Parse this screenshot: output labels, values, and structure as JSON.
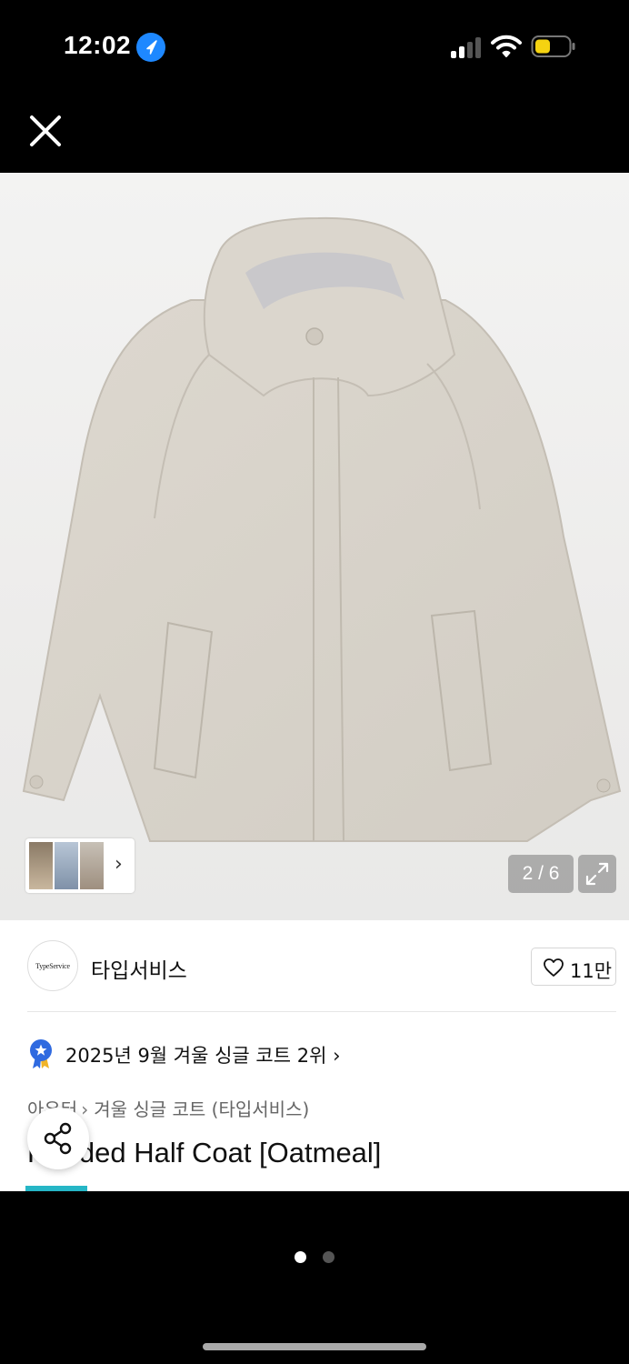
{
  "status_bar": {
    "time": "12:02",
    "icons": [
      "location-arrow-icon",
      "signal-icon",
      "wifi-icon",
      "battery-icon"
    ],
    "battery_color": "#f5d311"
  },
  "nav": {
    "close_icon": "close-icon"
  },
  "gallery": {
    "page_indicator": "2 / 6",
    "thumbnail_chevron": "›",
    "expand_icon": "expand-icon"
  },
  "brand": {
    "logo_text": "TypeService",
    "name": "타입서비스",
    "like_count": "11만"
  },
  "ranking": {
    "text": "2025년 9월 겨울 싱글 코트 2위",
    "chevron": "›",
    "badge_color": "#2f6ae0"
  },
  "breadcrumb": {
    "items": [
      "아우터",
      "겨울 싱글 코트 (타입서비스)"
    ],
    "separator": "›"
  },
  "product": {
    "title": "Hooded Half Coat [Oatmeal]"
  },
  "colors": {
    "accent_tag": "#26b6c6"
  },
  "pager": {
    "count": 2,
    "active_index": 0
  }
}
